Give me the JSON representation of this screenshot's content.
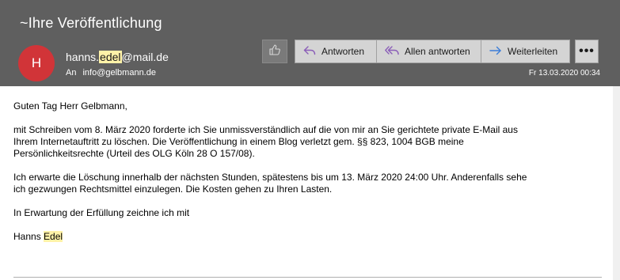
{
  "message": {
    "subject": "~Ihre Veröffentlichung",
    "avatar_initial": "H",
    "avatar_color": "#d13438",
    "from": {
      "prefix": "hanns.",
      "highlight": "edel",
      "suffix": "@mail.de"
    },
    "to_label": "An",
    "to_address": "info@gelbmann.de",
    "date": "Fr 13.03.2020 00:34"
  },
  "toolbar": {
    "like_icon": "thumbs-up-icon",
    "reply_label": "Antworten",
    "reply_all_label": "Allen antworten",
    "forward_label": "Weiterleiten",
    "more_label": "•••"
  },
  "body": {
    "greeting": "Guten Tag Herr Gelbmann,",
    "paragraph1_line1": "mit Schreiben vom 8. März 2020 forderte ich Sie unmissverständlich auf die von mir an Sie gerichtete private E-Mail aus",
    "paragraph1_line2": "Ihrem Internetauftritt zu löschen. Die Veröffentlichung in einem Blog verletzt gem. §§ 823, 1004 BGB meine",
    "paragraph1_line3": "Persönlichkeitsrechte (Urteil des OLG Köln 28 O 157/08).",
    "paragraph2_line1": "Ich erwarte die Löschung innerhalb der nächsten Stunden, spätestens bis um 13. März 2020 24:00 Uhr. Anderenfalls sehe",
    "paragraph2_line2": "ich gezwungen Rechtsmittel einzulegen. Die Kosten gehen zu Ihren Lasten.",
    "closing": "In Erwartung der Erfüllung zeichne ich mit",
    "signature_first": "Hanns",
    "signature_last": "Edel"
  },
  "colors": {
    "header_bg": "#5f5f5f",
    "highlight": "#fff2a8",
    "reply_icon": "#8a5db8",
    "forward_icon": "#3b7dd8"
  }
}
